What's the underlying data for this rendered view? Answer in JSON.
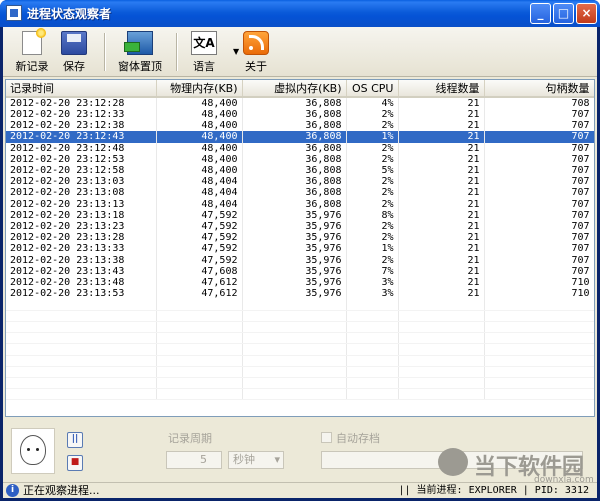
{
  "window": {
    "title": "进程状态观察者",
    "controls": {
      "minimize": "_",
      "maximize": "□",
      "close": "×"
    }
  },
  "toolbar": {
    "new_record": "新记录",
    "save": "保存",
    "pin_window": "窗体置顶",
    "language": "语言",
    "about": "关于",
    "language_icon_text": "文A"
  },
  "table": {
    "headers": [
      "记录时间",
      "物理内存(KB)",
      "虚拟内存(KB)",
      "OS CPU",
      "线程数量",
      "句柄数量"
    ],
    "rows": [
      [
        "2012-02-20 23:12:28",
        "48,400",
        "36,808",
        "4%",
        "21",
        "708"
      ],
      [
        "2012-02-20 23:12:33",
        "48,400",
        "36,808",
        "2%",
        "21",
        "707"
      ],
      [
        "2012-02-20 23:12:38",
        "48,400",
        "36,808",
        "2%",
        "21",
        "707"
      ],
      [
        "2012-02-20 23:12:43",
        "48,400",
        "36,808",
        "1%",
        "21",
        "707"
      ],
      [
        "2012-02-20 23:12:48",
        "48,400",
        "36,808",
        "2%",
        "21",
        "707"
      ],
      [
        "2012-02-20 23:12:53",
        "48,400",
        "36,808",
        "2%",
        "21",
        "707"
      ],
      [
        "2012-02-20 23:12:58",
        "48,400",
        "36,808",
        "5%",
        "21",
        "707"
      ],
      [
        "2012-02-20 23:13:03",
        "48,404",
        "36,808",
        "2%",
        "21",
        "707"
      ],
      [
        "2012-02-20 23:13:08",
        "48,404",
        "36,808",
        "2%",
        "21",
        "707"
      ],
      [
        "2012-02-20 23:13:13",
        "48,404",
        "36,808",
        "2%",
        "21",
        "707"
      ],
      [
        "2012-02-20 23:13:18",
        "47,592",
        "35,976",
        "8%",
        "21",
        "707"
      ],
      [
        "2012-02-20 23:13:23",
        "47,592",
        "35,976",
        "2%",
        "21",
        "707"
      ],
      [
        "2012-02-20 23:13:28",
        "47,592",
        "35,976",
        "2%",
        "21",
        "707"
      ],
      [
        "2012-02-20 23:13:33",
        "47,592",
        "35,976",
        "1%",
        "21",
        "707"
      ],
      [
        "2012-02-20 23:13:38",
        "47,592",
        "35,976",
        "2%",
        "21",
        "707"
      ],
      [
        "2012-02-20 23:13:43",
        "47,608",
        "35,976",
        "7%",
        "21",
        "707"
      ],
      [
        "2012-02-20 23:13:48",
        "47,612",
        "35,976",
        "3%",
        "21",
        "710"
      ],
      [
        "2012-02-20 23:13:53",
        "47,612",
        "35,976",
        "3%",
        "21",
        "710"
      ]
    ],
    "selected_row": 3
  },
  "settings": {
    "record_period_label": "记录周期",
    "period_value": "5",
    "period_unit": "秒钟",
    "autosave_label": "自动存档",
    "pause_glyph": "||",
    "stop_glyph": "■"
  },
  "watermark": {
    "text": "当下软件园",
    "sub": "downxia.com"
  },
  "status": {
    "left": "正在观察进程...",
    "right": "|| 当前进程: EXPLORER | PID: 3312",
    "info_glyph": "i"
  }
}
